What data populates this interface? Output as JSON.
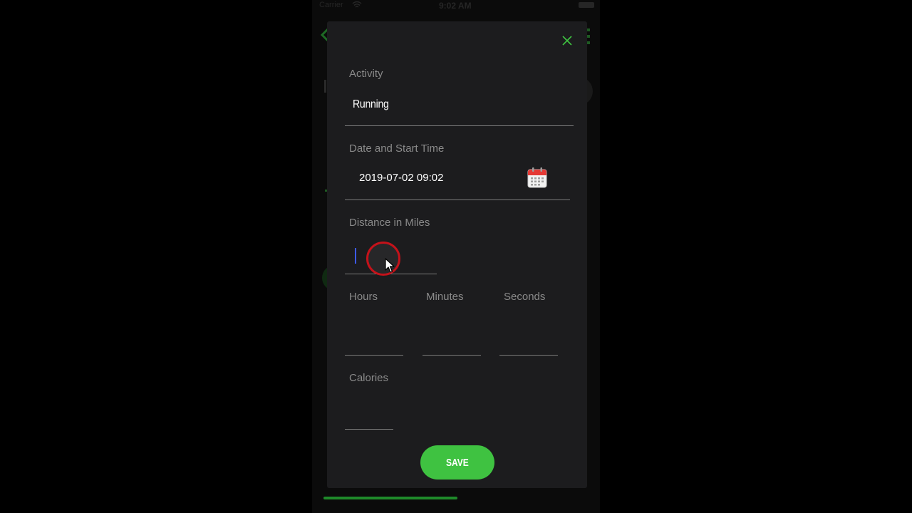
{
  "status_bar": {
    "carrier": "Carrier",
    "time": "9:02 AM"
  },
  "modal": {
    "close_icon": "close-icon",
    "activity": {
      "label": "Activity",
      "value": "Running"
    },
    "date_time": {
      "label": "Date and Start Time",
      "value": "2019-07-02 09:02",
      "icon": "calendar-icon"
    },
    "distance": {
      "label": "Distance in Miles",
      "value": ""
    },
    "duration": {
      "hours_label": "Hours",
      "minutes_label": "Minutes",
      "seconds_label": "Seconds",
      "hours_value": "",
      "minutes_value": "",
      "seconds_value": ""
    },
    "calories": {
      "label": "Calories",
      "value": ""
    },
    "save_label": "SAVE"
  },
  "colors": {
    "accent": "#3fc241",
    "close": "#3fc241",
    "modal_bg": "#1c1c1e",
    "label": "#8a8a8a",
    "caret": "#3d5afe",
    "click_indicator": "#c4121a"
  }
}
